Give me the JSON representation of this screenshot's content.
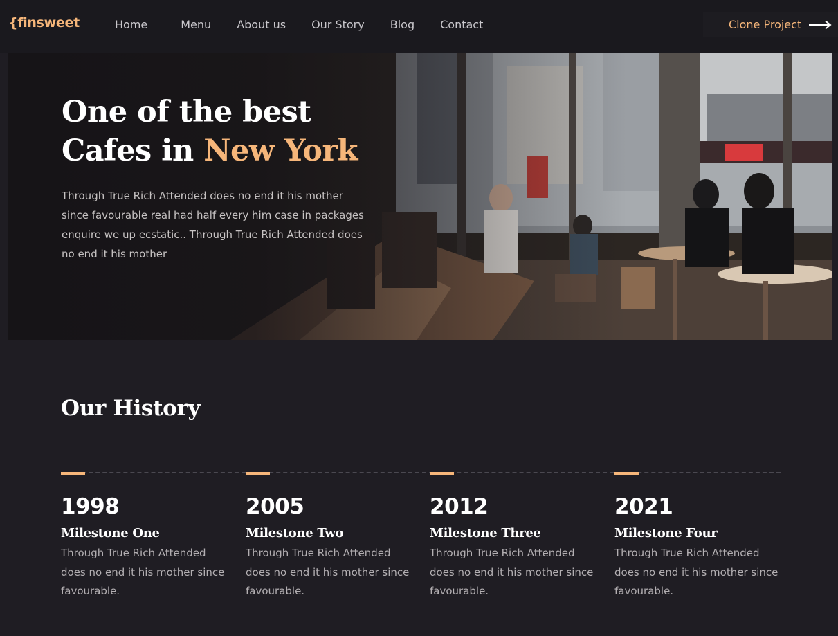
{
  "nav": {
    "logo": "{finsweet",
    "links": [
      "Home",
      "Menu",
      "About us",
      "Our Story",
      "Blog",
      "Contact"
    ],
    "clone_label": "Clone Project"
  },
  "hero": {
    "title_line1": "One of the best",
    "title_line2_prefix": "Cafes in ",
    "title_line2_accent": "New York",
    "description": "Through True Rich Attended does no end it his mother since favourable real had half every him case in packages enquire we up ecstatic.. Through True Rich Attended does no end it his mother"
  },
  "history": {
    "title": "Our History",
    "milestones": [
      {
        "year": "1998",
        "title": "Milestone One",
        "desc": "Through True Rich Attended does no end it his mother since favourable."
      },
      {
        "year": "2005",
        "title": "Milestone Two",
        "desc": "Through True Rich Attended does no end it his mother since favourable."
      },
      {
        "year": "2012",
        "title": "Milestone Three",
        "desc": "Through True Rich Attended does no end it his mother since favourable."
      },
      {
        "year": "2021",
        "title": "Milestone Four",
        "desc": "Through True Rich Attended does no end it his mother since favourable."
      }
    ]
  },
  "colors": {
    "accent": "#f6b67a",
    "background": "#1f1d23",
    "nav_background": "#1a191e"
  }
}
